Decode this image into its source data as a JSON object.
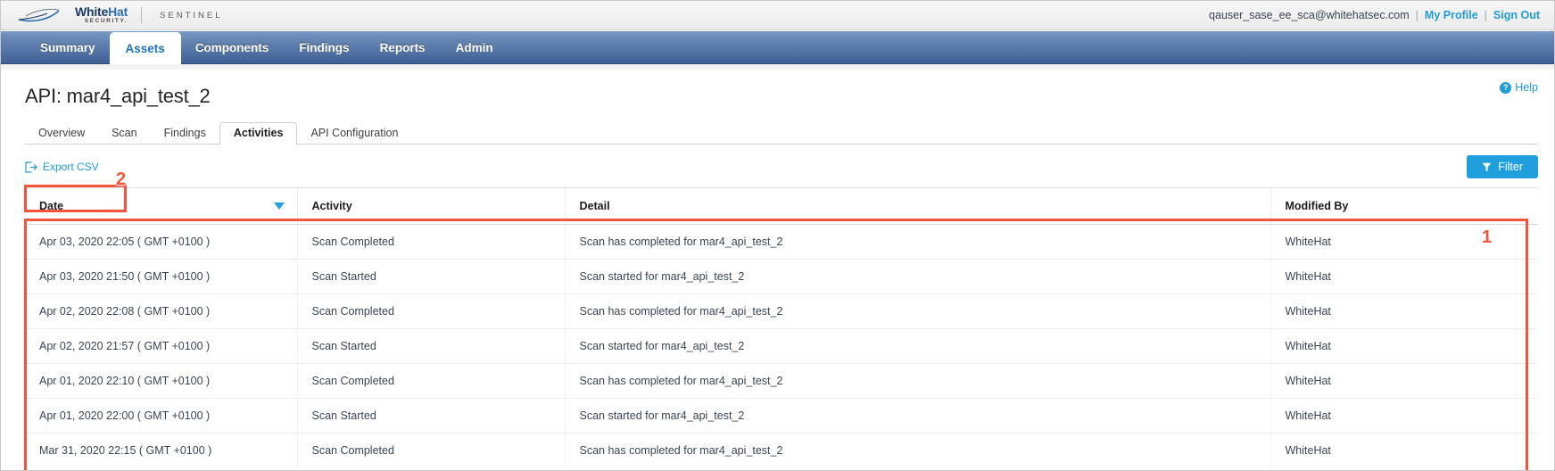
{
  "brand": {
    "logo_primary": "White",
    "logo_secondary": "Hat",
    "logo_sub": "SECURITY.",
    "product": "SENTINEL"
  },
  "topbar": {
    "user_email": "qauser_sase_ee_sca@whitehatsec.com",
    "separator": "|",
    "my_profile": "My Profile",
    "sign_out": "Sign Out"
  },
  "mainnav": {
    "tabs": [
      {
        "label": "Summary",
        "active": false
      },
      {
        "label": "Assets",
        "active": true
      },
      {
        "label": "Components",
        "active": false
      },
      {
        "label": "Findings",
        "active": false
      },
      {
        "label": "Reports",
        "active": false
      },
      {
        "label": "Admin",
        "active": false
      }
    ]
  },
  "page": {
    "title": "API: mar4_api_test_2",
    "help_label": "Help",
    "help_icon_glyph": "?"
  },
  "subtabs": [
    {
      "label": "Overview",
      "active": false
    },
    {
      "label": "Scan",
      "active": false
    },
    {
      "label": "Findings",
      "active": false
    },
    {
      "label": "Activities",
      "active": true
    },
    {
      "label": "API Configuration",
      "active": false
    }
  ],
  "toolbar": {
    "export_label": "Export CSV",
    "export_icon": "export-icon",
    "filter_label": "Filter",
    "filter_icon": "funnel-icon"
  },
  "table": {
    "columns": [
      {
        "key": "date",
        "label": "Date",
        "sorted": "desc"
      },
      {
        "key": "activity",
        "label": "Activity",
        "sorted": null
      },
      {
        "key": "detail",
        "label": "Detail",
        "sorted": null
      },
      {
        "key": "modified_by",
        "label": "Modified By",
        "sorted": null
      }
    ],
    "rows": [
      {
        "date": "Apr 03, 2020 22:05 ( GMT +0100 )",
        "activity": "Scan Completed",
        "detail": "Scan has completed for mar4_api_test_2",
        "modified_by": "WhiteHat"
      },
      {
        "date": "Apr 03, 2020 21:50 ( GMT +0100 )",
        "activity": "Scan Started",
        "detail": "Scan started for mar4_api_test_2",
        "modified_by": "WhiteHat"
      },
      {
        "date": "Apr 02, 2020 22:08 ( GMT +0100 )",
        "activity": "Scan Completed",
        "detail": "Scan has completed for mar4_api_test_2",
        "modified_by": "WhiteHat"
      },
      {
        "date": "Apr 02, 2020 21:57 ( GMT +0100 )",
        "activity": "Scan Started",
        "detail": "Scan started for mar4_api_test_2",
        "modified_by": "WhiteHat"
      },
      {
        "date": "Apr 01, 2020 22:10 ( GMT +0100 )",
        "activity": "Scan Completed",
        "detail": "Scan has completed for mar4_api_test_2",
        "modified_by": "WhiteHat"
      },
      {
        "date": "Apr 01, 2020 22:00 ( GMT +0100 )",
        "activity": "Scan Started",
        "detail": "Scan started for mar4_api_test_2",
        "modified_by": "WhiteHat"
      },
      {
        "date": "Mar 31, 2020 22:15 ( GMT +0100 )",
        "activity": "Scan Completed",
        "detail": "Scan has completed for mar4_api_test_2",
        "modified_by": "WhiteHat"
      }
    ]
  },
  "annotations": [
    {
      "number": "1",
      "target": "activities-table"
    },
    {
      "number": "2",
      "target": "export-csv-link"
    }
  ],
  "colors": {
    "accent_blue": "#1fa0dd",
    "link_blue": "#1f9bd8",
    "nav_blue": "#46669a",
    "annotation_red": "#f4543c",
    "text_dark": "#3b4452"
  }
}
